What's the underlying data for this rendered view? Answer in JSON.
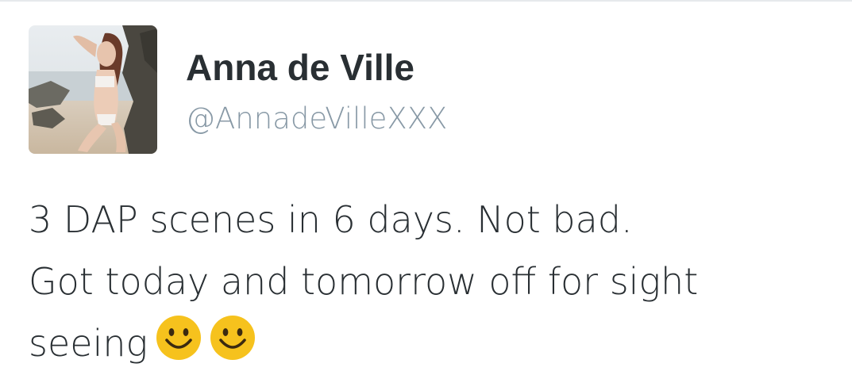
{
  "tweet": {
    "author": {
      "display_name": "Anna de Ville",
      "handle": "@AnnadeVilleXXX",
      "avatar_icon": "profile-photo"
    },
    "text_lines": [
      "3 DAP scenes in 6 days. Not bad.",
      "Got today and tomorrow off for sight",
      "seeing"
    ],
    "emojis": [
      "smiling-face-emoji",
      "smiling-face-emoji"
    ]
  },
  "colors": {
    "name_text": "#292f33",
    "handle_text": "#8899a6",
    "body_text": "#292f33",
    "emoji_face": "#f6c21d",
    "divider": "#e6e9ec"
  }
}
